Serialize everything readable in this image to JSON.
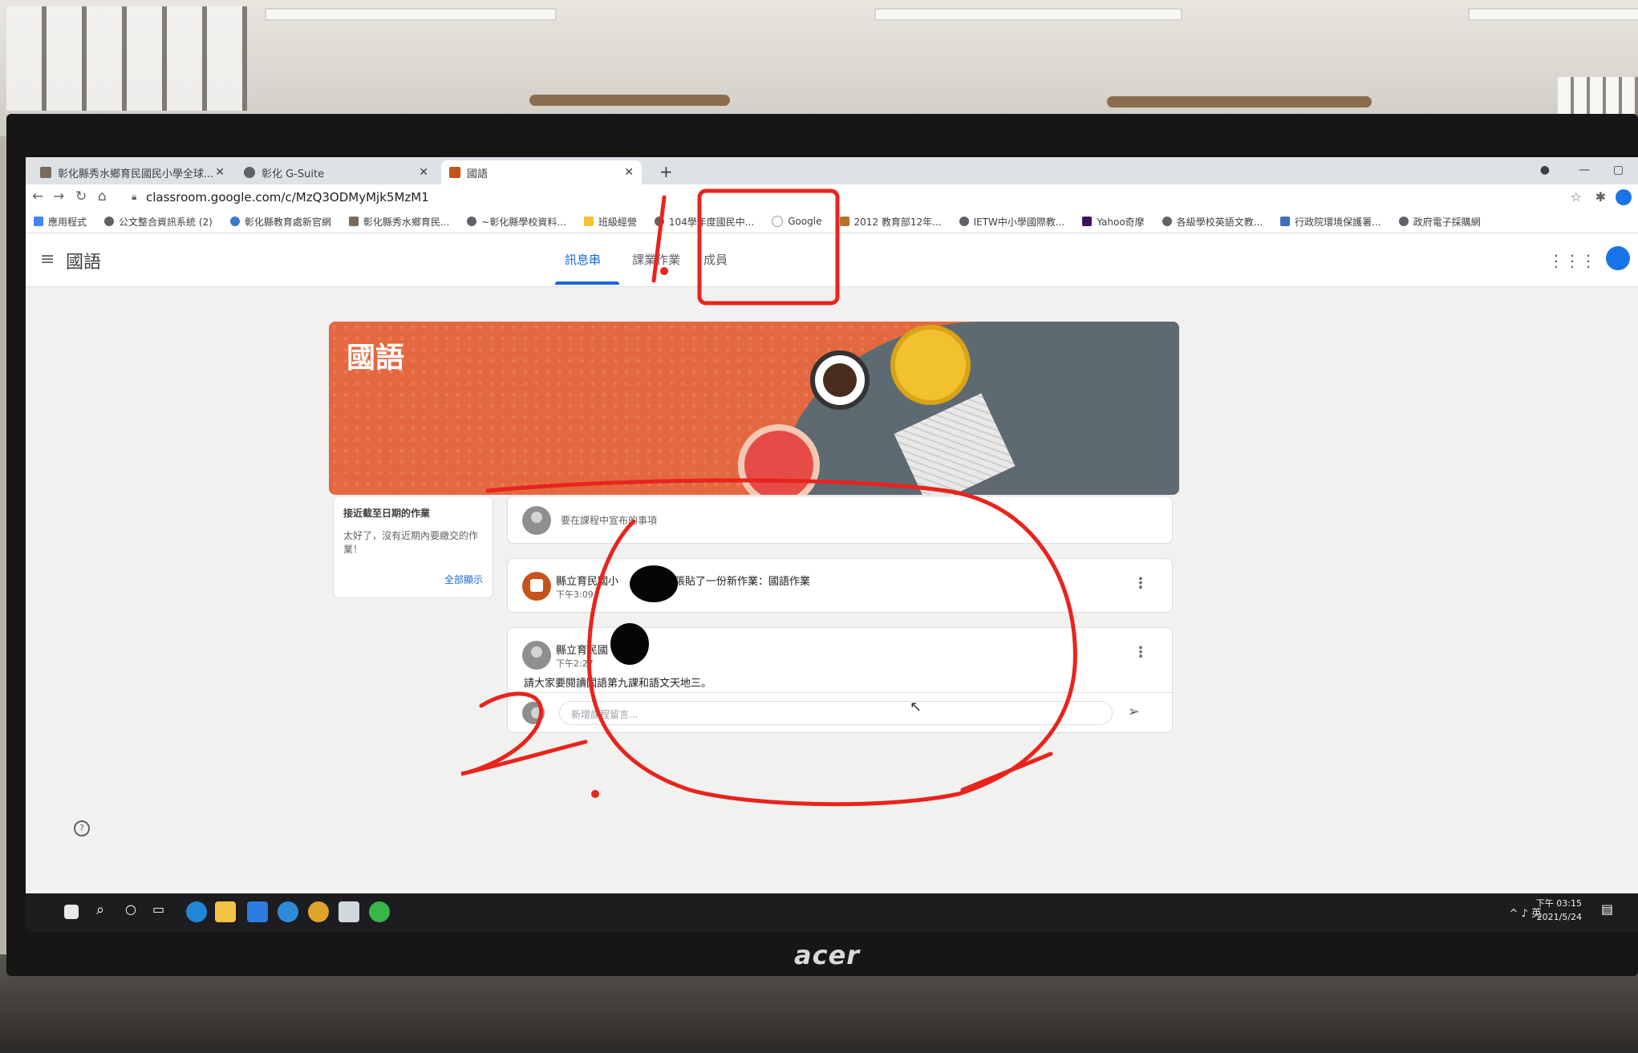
{
  "browser": {
    "tabs": [
      {
        "label": "彰化縣秀水鄉育民國民小學全球..."
      },
      {
        "label": "彰化 G-Suite"
      },
      {
        "label": "國語"
      }
    ],
    "url": "classroom.google.com/c/MzQ3ODMyMjk5MzM1",
    "bookmarks": [
      "應用程式",
      "公文整合資訊系統 (2)",
      "彰化縣教育處新官網",
      "彰化縣秀水鄉育民...",
      "~彰化縣學校資料...",
      "班級經營",
      "104學年度國民中...",
      "Google",
      "2012 教育部12年...",
      "IETW中小學國際教...",
      "Yahoo奇摩",
      "各級學校英語文教...",
      "行政院環境保護署...",
      "政府電子採購網"
    ]
  },
  "classroom": {
    "course_title": "國語",
    "tabs": [
      {
        "label": "訊息串",
        "active": true
      },
      {
        "label": "課業作業",
        "active": false
      },
      {
        "label": "成員",
        "active": false
      }
    ],
    "banner_title": "國語",
    "upcoming": {
      "title": "接近截至日期的作業",
      "message": "太好了，沒有近期內要繳交的作業！",
      "link": "全部顯示"
    },
    "announce_placeholder": "要在課程中宣布的事項",
    "posts": [
      {
        "author": "縣立育民國小",
        "action": "張貼了一份新作業：國語作業",
        "time": "下午3:09"
      },
      {
        "author": "縣立育民國",
        "time": "下午2:27",
        "body": "請大家要閱讀國語第九課和語文天地三。"
      }
    ],
    "comment_placeholder": "新增課程留言..."
  },
  "taskbar": {
    "tray_text": "^ ♪ 英",
    "clock_time": "下午 03:15",
    "clock_date": "2021/5/24"
  },
  "monitor_brand": "acer",
  "annotations": {
    "mark_1": "1.",
    "mark_2": "2."
  },
  "colors": {
    "accent": "#1967d2",
    "banner": "#e4683f",
    "annotation_red": "#e8241d"
  }
}
